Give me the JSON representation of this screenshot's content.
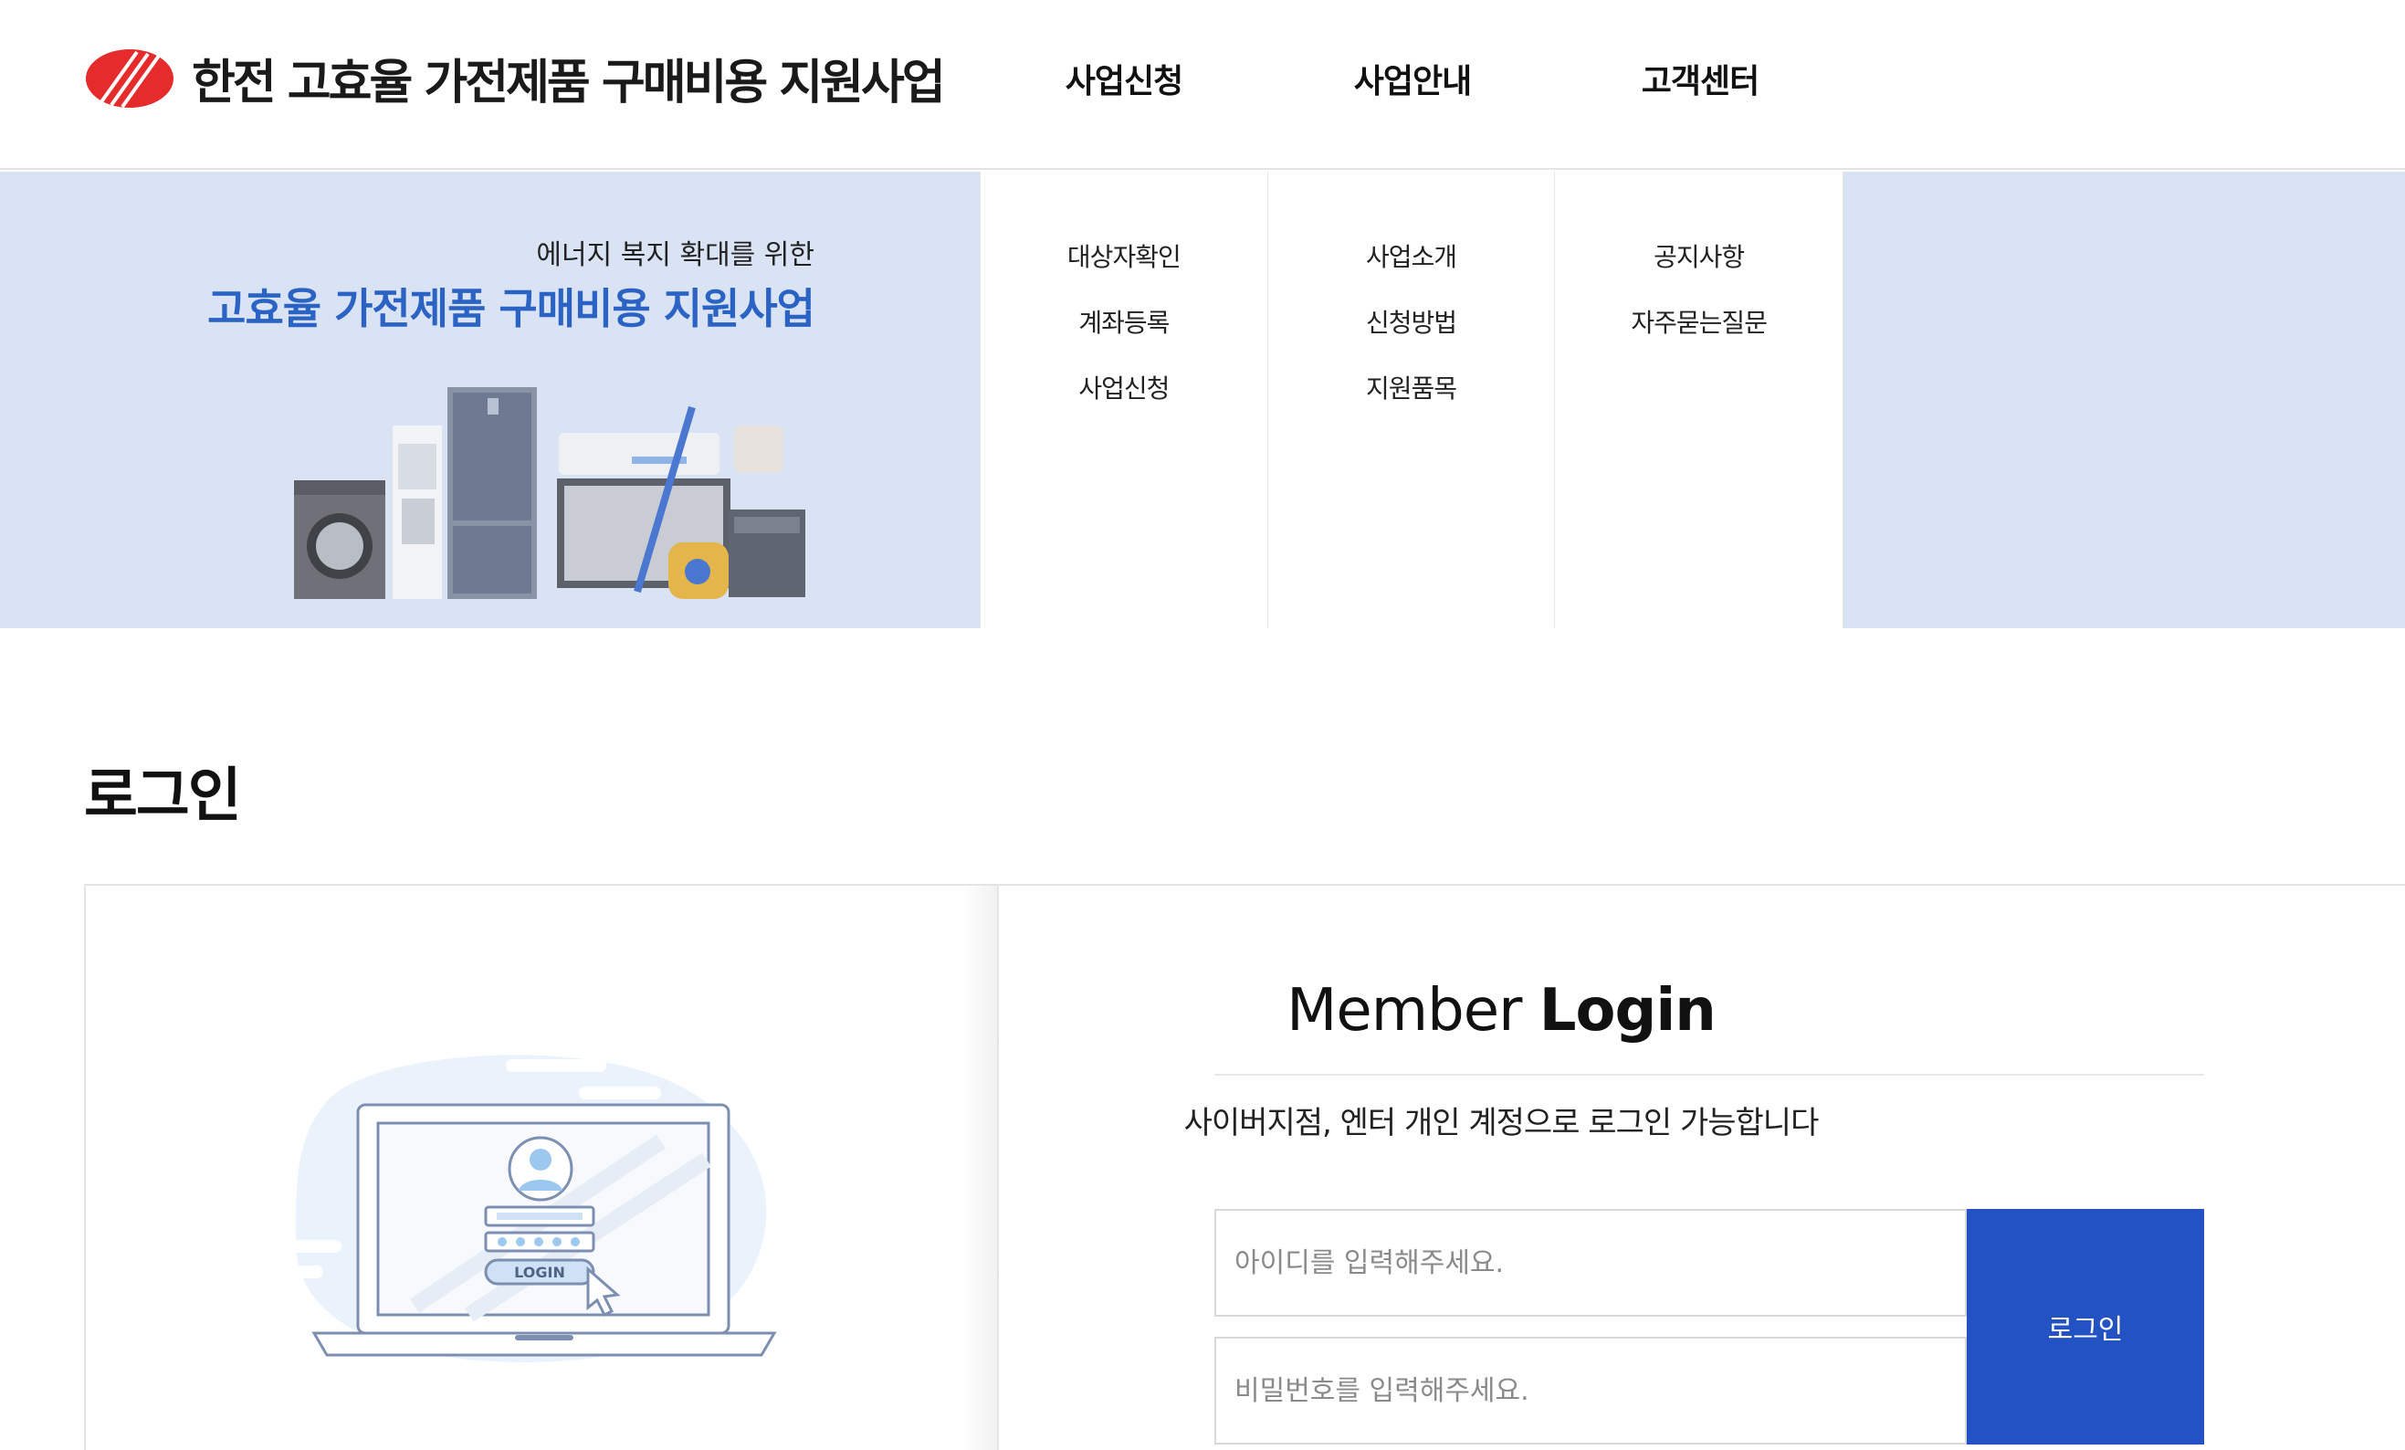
{
  "brand": {
    "name": "한전 고효율 가전제품 구매비용 지원사업",
    "logo_color": "#e52b2b"
  },
  "nav": {
    "items": [
      {
        "label": "사업신청",
        "submenu": [
          "대상자확인",
          "계좌등록",
          "사업신청"
        ]
      },
      {
        "label": "사업안내",
        "submenu": [
          "사업소개",
          "신청방법",
          "지원품목"
        ]
      },
      {
        "label": "고객센터",
        "submenu": [
          "공지사항",
          "자주묻는질문"
        ]
      }
    ]
  },
  "banner": {
    "subtitle": "에너지 복지 확대를 위한",
    "title": "고효율 가전제품 구매비용 지원사업",
    "background": "#d9e3f4",
    "title_color": "#2b63c4"
  },
  "page": {
    "title": "로그인"
  },
  "login": {
    "title_light": "Member ",
    "title_bold": "Login",
    "description": "사이버지점, 엔터 개인 계정으로 로그인 가능합니다",
    "id_placeholder": "아이디를 입력해주세요.",
    "pw_placeholder": "비밀번호를 입력해주세요.",
    "button_label": "로그인",
    "button_color": "#2352c3",
    "illustration_button": "LOGIN"
  }
}
